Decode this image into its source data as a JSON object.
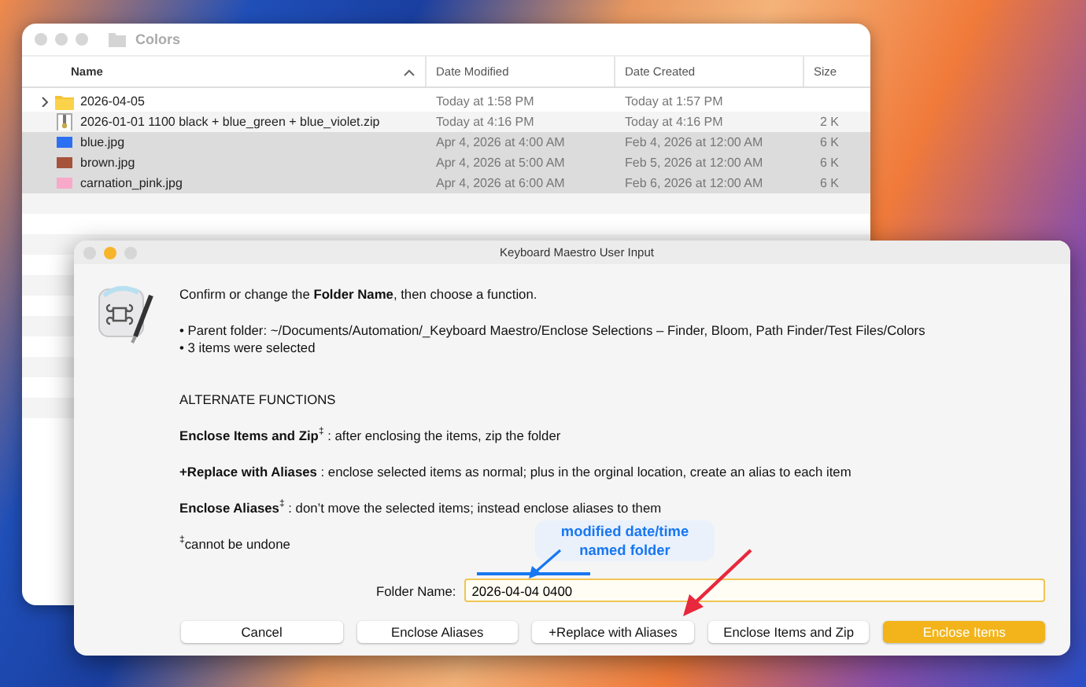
{
  "finder": {
    "title": "Colors",
    "columns": [
      {
        "label": "Name",
        "sorted": true
      },
      {
        "label": "Date Modified",
        "sorted": false
      },
      {
        "label": "Date Created",
        "sorted": false
      },
      {
        "label": "Size",
        "sorted": false
      }
    ],
    "rows": [
      {
        "kind": "folder",
        "name": "2026-04-05",
        "modified": "Today at 1:58 PM",
        "created": "Today at 1:57 PM",
        "size": "",
        "expanded": false,
        "selected": false
      },
      {
        "kind": "zip",
        "name": "2026-01-01 1100 black + blue_green + blue_violet.zip",
        "modified": "Today at 4:16 PM",
        "created": "Today at 4:16 PM",
        "size": "2 K",
        "selected": false
      },
      {
        "kind": "image",
        "color": "#2b6ff2",
        "name": "blue.jpg",
        "modified": "Apr 4, 2026 at 4:00 AM",
        "created": "Feb 4, 2026 at 12:00 AM",
        "size": "6 K",
        "selected": true
      },
      {
        "kind": "image",
        "color": "#a6533b",
        "name": "brown.jpg",
        "modified": "Apr 4, 2026 at 5:00 AM",
        "created": "Feb 5, 2026 at 12:00 AM",
        "size": "6 K",
        "selected": true
      },
      {
        "kind": "image",
        "color": "#f8a9c9",
        "name": "carnation_pink.jpg",
        "modified": "Apr 4, 2026 at 6:00 AM",
        "created": "Feb 6, 2026 at 12:00 AM",
        "size": "6 K",
        "selected": true
      }
    ]
  },
  "dialog": {
    "title": "Keyboard Maestro User Input",
    "intro": "Confirm or change the **Folder Name**, then choose a function.",
    "bullets": [
      "• Parent folder: ~/Documents/Automation/_Keyboard Maestro/Enclose Selections – Finder, Bloom, Path Finder/Test Files/Colors",
      "• 3 items were selected"
    ],
    "section_heading": "ALTERNATE FUNCTIONS",
    "descriptions": [
      "**Enclose Items and Zip**$^{‡}$ : after enclosing the items, zip the folder",
      "**+Replace with Aliases** : enclose selected items as normal; plus in the orginal location, create an alias to each item",
      "**Enclose Aliases**$^{‡}$ : don’t move the selected items; instead enclose aliases to them"
    ],
    "footnote": "$^{‡}$cannot be undone",
    "field": {
      "label": "Folder Name:",
      "value": "2026-04-04 0400"
    },
    "buttons": [
      {
        "label": "Cancel",
        "default": false
      },
      {
        "label": "Enclose Aliases",
        "default": false
      },
      {
        "label": "+Replace with Aliases",
        "default": false
      },
      {
        "label": "Enclose Items and Zip",
        "default": false
      },
      {
        "label": "Enclose Items",
        "default": true
      }
    ]
  },
  "annotation": {
    "text": "modified date/time named folder"
  }
}
